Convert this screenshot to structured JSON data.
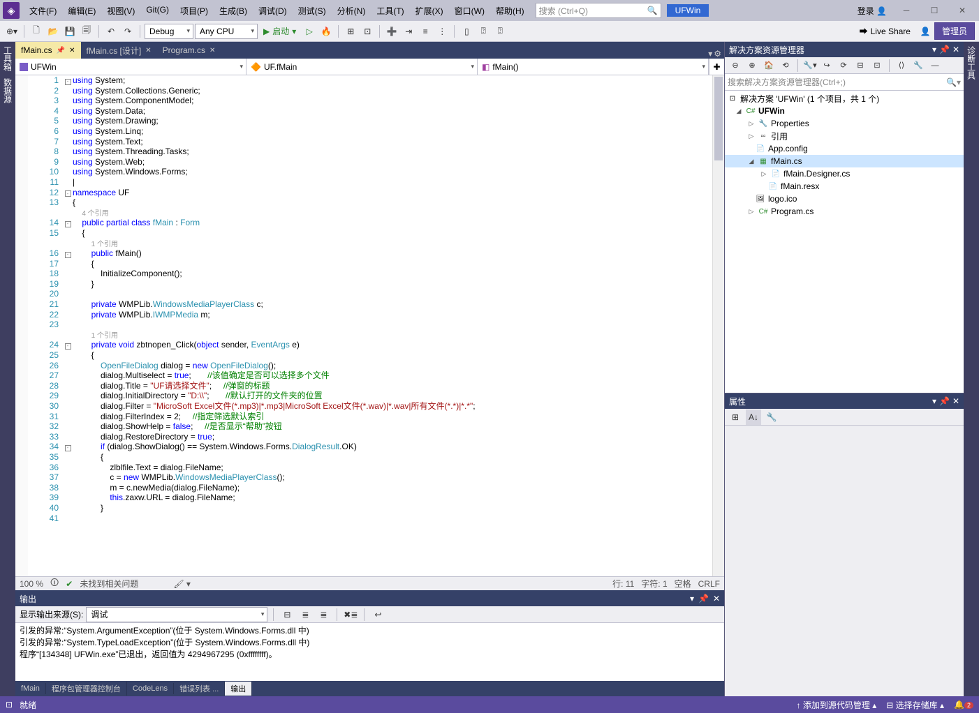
{
  "titlebar": {
    "menus": [
      "文件(F)",
      "编辑(E)",
      "视图(V)",
      "Git(G)",
      "项目(P)",
      "生成(B)",
      "调试(D)",
      "测试(S)",
      "分析(N)",
      "工具(T)",
      "扩展(X)",
      "窗口(W)",
      "帮助(H)"
    ],
    "search_placeholder": "搜索 (Ctrl+Q)",
    "solution_name": "UFWin",
    "login": "登录",
    "admin_btn": "管理员"
  },
  "toolbar": {
    "config": "Debug",
    "platform": "Any CPU",
    "start": "启动",
    "live_share": "Live Share"
  },
  "left_strip": [
    "工具箱",
    "数据源"
  ],
  "right_strip": "诊断工具",
  "doc_tabs": [
    {
      "label": "fMain.cs",
      "active": true,
      "pinned": true
    },
    {
      "label": "fMain.cs [设计]",
      "active": false
    },
    {
      "label": "Program.cs",
      "active": false
    }
  ],
  "nav": {
    "project": "UFWin",
    "class": "UF.fMain",
    "member": "fMain()"
  },
  "refs": {
    "four": "4 个引用",
    "one": "1 个引用"
  },
  "code_lines": [
    {
      "n": 1,
      "fold": "-",
      "html": "<span class='k'>using</span> System;"
    },
    {
      "n": 2,
      "html": "<span class='k'>using</span> System.Collections.Generic;"
    },
    {
      "n": 3,
      "html": "<span class='k'>using</span> System.ComponentModel;"
    },
    {
      "n": 4,
      "html": "<span class='k'>using</span> System.Data;"
    },
    {
      "n": 5,
      "html": "<span class='k'>using</span> System.Drawing;"
    },
    {
      "n": 6,
      "html": "<span class='k'>using</span> System.Linq;"
    },
    {
      "n": 7,
      "html": "<span class='k'>using</span> System.Text;"
    },
    {
      "n": 8,
      "html": "<span class='k'>using</span> System.Threading.Tasks;"
    },
    {
      "n": 9,
      "html": "<span class='k'>using</span> System.Web;"
    },
    {
      "n": 10,
      "html": "<span class='k'>using</span> System.Windows.Forms;"
    },
    {
      "n": 11,
      "html": "|"
    },
    {
      "n": 12,
      "fold": "-",
      "html": "<span class='k'>namespace</span> UF"
    },
    {
      "n": 13,
      "html": "{"
    },
    {
      "n": "",
      "html": "    <span class='ref' data-bind='refs.four'></span>"
    },
    {
      "n": 14,
      "fold": "-",
      "html": "    <span class='k'>public</span> <span class='k'>partial</span> <span class='k'>class</span> <span class='t'>fMain</span> : <span class='t'>Form</span>"
    },
    {
      "n": 15,
      "html": "    {"
    },
    {
      "n": "",
      "html": "        <span class='ref' data-bind='refs.one'></span>"
    },
    {
      "n": 16,
      "fold": "-",
      "html": "        <span class='k'>public</span> fMain()"
    },
    {
      "n": 17,
      "html": "        {"
    },
    {
      "n": 18,
      "html": "            InitializeComponent();"
    },
    {
      "n": 19,
      "html": "        }"
    },
    {
      "n": 20,
      "html": ""
    },
    {
      "n": 21,
      "html": "        <span class='k'>private</span> WMPLib.<span class='t'>WindowsMediaPlayerClass</span> c;"
    },
    {
      "n": 22,
      "html": "        <span class='k'>private</span> WMPLib.<span class='t'>IWMPMedia</span> m;"
    },
    {
      "n": 23,
      "html": ""
    },
    {
      "n": "",
      "html": "        <span class='ref' data-bind='refs.one'></span>"
    },
    {
      "n": 24,
      "fold": "-",
      "html": "        <span class='k'>private</span> <span class='k'>void</span> zbtnopen_Click(<span class='k'>object</span> sender, <span class='t'>EventArgs</span> e)"
    },
    {
      "n": 25,
      "html": "        {"
    },
    {
      "n": 26,
      "html": "            <span class='t'>OpenFileDialog</span> dialog = <span class='k'>new</span> <span class='t'>OpenFileDialog</span>();"
    },
    {
      "n": 27,
      "html": "            dialog.Multiselect = <span class='k'>true</span>;       <span class='c'>//该值确定是否可以选择多个文件</span>"
    },
    {
      "n": 28,
      "html": "            dialog.Title = <span class='s'>\"UF请选择文件\"</span>;     <span class='c'>//弹窗的标题</span>"
    },
    {
      "n": 29,
      "html": "            dialog.InitialDirectory = <span class='s'>\"D:\\\\\"</span>;       <span class='c'>//默认打开的文件夹的位置</span>"
    },
    {
      "n": 30,
      "html": "            dialog.Filter = <span class='s'>\"MicroSoft Excel文件(*.mp3)|*.mp3|MicroSoft Excel文件(*.wav)|*.wav|所有文件(*.*)|*.*\"</span>;"
    },
    {
      "n": 31,
      "html": "            dialog.FilterIndex = 2;     <span class='c'>//指定筛选默认索引</span>"
    },
    {
      "n": 32,
      "html": "            dialog.ShowHelp = <span class='k'>false</span>;     <span class='c'>//是否显示“帮助”按钮</span>"
    },
    {
      "n": 33,
      "html": "            dialog.RestoreDirectory = <span class='k'>true</span>;"
    },
    {
      "n": 34,
      "fold": "-",
      "html": "            <span class='k'>if</span> (dialog.ShowDialog() == System.Windows.Forms.<span class='t'>DialogResult</span>.OK)"
    },
    {
      "n": 35,
      "html": "            {"
    },
    {
      "n": 36,
      "html": "                zlblfile.Text = dialog.FileName;"
    },
    {
      "n": 37,
      "html": "                c = <span class='k'>new</span> WMPLib.<span class='t'>WindowsMediaPlayerClass</span>();"
    },
    {
      "n": 38,
      "html": "                m = c.newMedia(dialog.FileName);"
    },
    {
      "n": 39,
      "html": "                <span class='k'>this</span>.zaxw.URL = dialog.FileName;"
    },
    {
      "n": 40,
      "html": "            }"
    },
    {
      "n": 41,
      "html": ""
    }
  ],
  "editor_status": {
    "zoom": "100 %",
    "issues": "未找到相关问题",
    "line": "行: 11",
    "col": "字符: 1",
    "ins": "空格",
    "enc": "CRLF"
  },
  "output": {
    "title": "输出",
    "source_label": "显示输出来源(S):",
    "source": "调试",
    "lines": [
      "引发的异常:“System.ArgumentException”(位于 System.Windows.Forms.dll 中)",
      "引发的异常:“System.TypeLoadException”(位于 System.Windows.Forms.dll 中)",
      "程序“[134348] UFWin.exe”已退出，返回值为 4294967295 (0xffffffff)。"
    ]
  },
  "bottom_tabs": [
    "fMain",
    "程序包管理器控制台",
    "CodeLens",
    "错误列表 ...",
    "输出"
  ],
  "sln": {
    "title": "解决方案资源管理器",
    "search_placeholder": "搜索解决方案资源管理器(Ctrl+;)",
    "root": "解决方案 'UFWin' (1 个项目，共 1 个)",
    "project": "UFWin",
    "nodes": {
      "properties": "Properties",
      "refs": "引用",
      "appconfig": "App.config",
      "fmain": "fMain.cs",
      "designer": "fMain.Designer.cs",
      "resx": "fMain.resx",
      "logo": "logo.ico",
      "program": "Program.cs"
    }
  },
  "props": {
    "title": "属性"
  },
  "statusbar": {
    "ready": "就绪",
    "src": "添加到源代码管理",
    "repo": "选择存储库",
    "bell_count": "2"
  }
}
